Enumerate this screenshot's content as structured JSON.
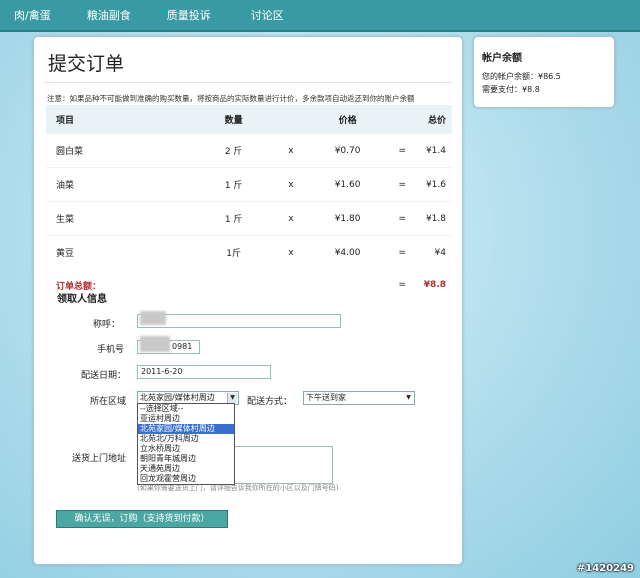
{
  "nav": [
    "肉/禽蛋",
    "粮油副食",
    "质量投诉",
    "讨论区"
  ],
  "order": {
    "title": "提交订单",
    "note": "注意：如果品种不可能做到准确的购买数量，将按商品的实际数量进行计价，多余款项自动返还到你的账户余额",
    "headers": {
      "item": "项目",
      "qty": "数量",
      "price": "价格",
      "total": "总价"
    },
    "rows": [
      {
        "item": "圆白菜",
        "qty": "2 斤",
        "x": "x",
        "price": "¥0.70",
        "eq": "=",
        "total": "¥1.4"
      },
      {
        "item": "油菜",
        "qty": "1 斤",
        "x": "x",
        "price": "¥1.60",
        "eq": "=",
        "total": "¥1.6"
      },
      {
        "item": "生菜",
        "qty": "1 斤",
        "x": "x",
        "price": "¥1.80",
        "eq": "=",
        "total": "¥1.8"
      },
      {
        "item": "黄豆",
        "qty": "1斤",
        "x": "x",
        "price": "¥4.00",
        "eq": "=",
        "total": "¥4"
      }
    ],
    "total_label": "订单总额：",
    "total_eq": "=",
    "total_value": "¥8.8"
  },
  "receiver": {
    "section_title": "领取人信息",
    "name_label": "称呼：",
    "phone_label": "手机号",
    "phone_suffix": "0981",
    "date_label": "配送日期：",
    "date_value": "2011-6-20",
    "area_label": "所在区域",
    "area_selected": "北苑家园/媒体村周边",
    "area_options": [
      "--选择区域--",
      "亚运村周边",
      "北苑家园/媒体村周边",
      "北苑北/万科周边",
      "立水桥周边",
      "朝阳青年城周边",
      "天通苑周边",
      "回龙观霍营周边"
    ],
    "area_selected_index": 2,
    "delivery_label": "配送方式：",
    "delivery_value": "下午送到家",
    "address_label": "送货上门地址",
    "address_hint": "(如果你需要送货上门，请详细告诉我你所在的小区以及门牌号码)",
    "submit_label": "确认无误，订购（支持货到付款）"
  },
  "balance": {
    "title": "帐户余额",
    "account_balance": "您的帐户余额：¥86.5",
    "need_pay": "需要支付：¥8.8"
  },
  "watermark": "#1420249"
}
